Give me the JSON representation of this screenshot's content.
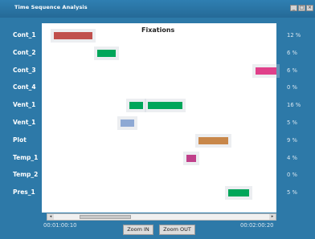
{
  "window": {
    "title": "Time Sequence Analysis",
    "controls": [
      "_",
      "□",
      "×"
    ]
  },
  "chart_data": {
    "type": "timeline",
    "title": "Fixations",
    "rows": [
      {
        "label": "Cont_1",
        "percent": "12 %",
        "fixations": [
          {
            "start": 0.03,
            "end": 0.2,
            "color": "#c0504d"
          }
        ]
      },
      {
        "label": "Cont_2",
        "percent": "6 %",
        "fixations": [
          {
            "start": 0.22,
            "end": 0.3,
            "color": "#00a65a"
          }
        ]
      },
      {
        "label": "Cont_3",
        "percent": "6 %",
        "fixations": [
          {
            "start": 0.91,
            "end": 1.0,
            "color": "#e0408a"
          }
        ]
      },
      {
        "label": "Cont_4",
        "percent": "0 %",
        "fixations": []
      },
      {
        "label": "Vent_1",
        "percent": "16 %",
        "fixations": [
          {
            "start": 0.36,
            "end": 0.42,
            "color": "#00a65a"
          },
          {
            "start": 0.44,
            "end": 0.59,
            "color": "#00a65a"
          }
        ]
      },
      {
        "label": "Vent_1",
        "percent": "5 %",
        "fixations": [
          {
            "start": 0.32,
            "end": 0.38,
            "color": "#8ea9d4"
          }
        ]
      },
      {
        "label": "Plot",
        "percent": "9 %",
        "fixations": [
          {
            "start": 0.66,
            "end": 0.79,
            "color": "#c8874a"
          }
        ]
      },
      {
        "label": "Temp_1",
        "percent": "4 %",
        "fixations": [
          {
            "start": 0.61,
            "end": 0.65,
            "color": "#c0408a"
          }
        ]
      },
      {
        "label": "Temp_2",
        "percent": "0 %",
        "fixations": []
      },
      {
        "label": "Pres_1",
        "percent": "5 %",
        "fixations": [
          {
            "start": 0.79,
            "end": 0.88,
            "color": "#00a65a"
          }
        ]
      }
    ]
  },
  "timeline": {
    "start_time": "00:01:00:10",
    "end_time": "00:02:00:20"
  },
  "buttons": {
    "zoom_in": "Zoom IN",
    "zoom_out": "Zoom OUT"
  },
  "scroll": {
    "left_arrow": "◂",
    "right_arrow": "▸"
  }
}
